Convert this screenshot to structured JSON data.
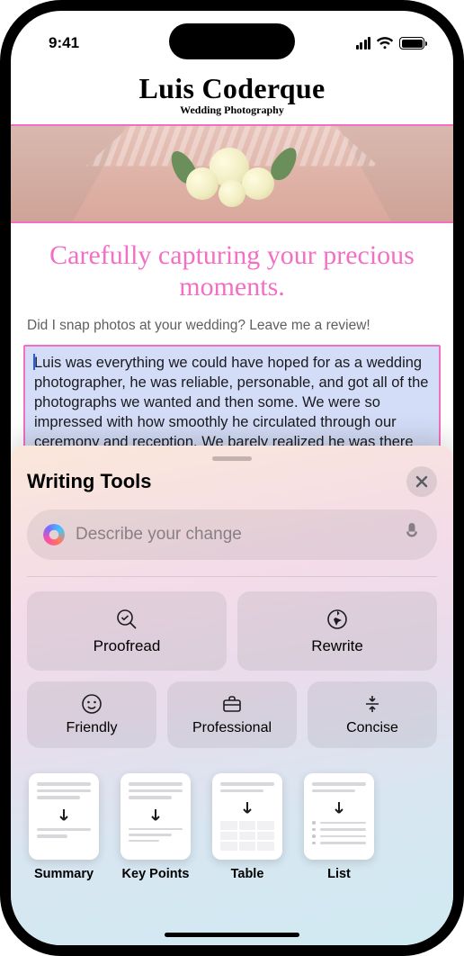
{
  "status": {
    "time": "9:41"
  },
  "brand": {
    "name": "Luis Coderque",
    "subtitle": "Wedding Photography"
  },
  "page": {
    "headline": "Carefully capturing your precious moments.",
    "prompt": "Did I snap photos at your wedding? Leave me a review!",
    "review_text": "Luis was everything we could have hoped for as a wedding photographer, he was reliable, personable, and got all of the photographs we wanted and then some. We were so impressed with how smoothly he circulated through our ceremony and reception. We barely realized he was there except when he was very"
  },
  "sheet": {
    "title": "Writing Tools",
    "input_placeholder": "Describe your change",
    "tools": {
      "proofread": "Proofread",
      "rewrite": "Rewrite",
      "friendly": "Friendly",
      "professional": "Professional",
      "concise": "Concise"
    },
    "transforms": {
      "summary": "Summary",
      "key_points": "Key Points",
      "table": "Table",
      "list": "List"
    }
  }
}
